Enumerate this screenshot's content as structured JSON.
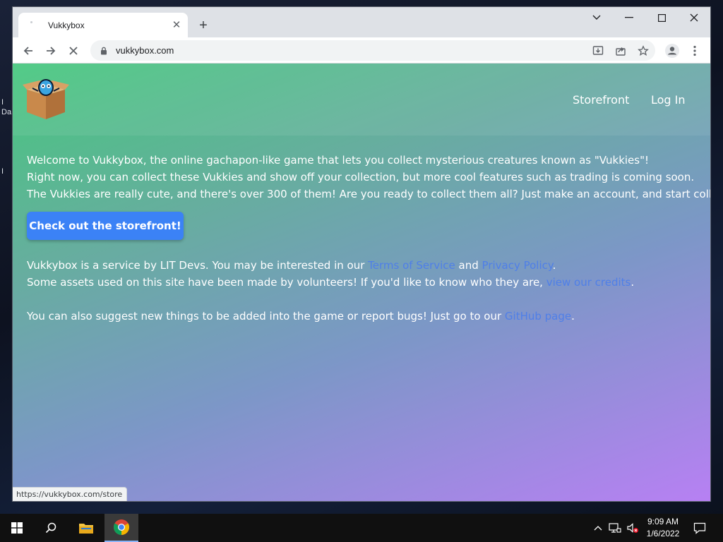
{
  "desktop": {
    "edge_labels": [
      "I",
      "Da",
      "I"
    ]
  },
  "browser": {
    "tab": {
      "title": "Vukkybox"
    },
    "address": {
      "url": "vukkybox.com"
    },
    "status_url": "https://vukkybox.com/store",
    "icons": {
      "back": "arrow-left-icon",
      "forward": "arrow-right-icon",
      "stop": "close-icon",
      "lock": "lock-icon",
      "install": "install-app-icon",
      "share": "share-icon",
      "bookmark": "star-icon",
      "profile": "profile-icon",
      "menu": "kebab-menu-icon"
    }
  },
  "site": {
    "nav": {
      "storefront": "Storefront",
      "login": "Log In"
    },
    "intro": [
      "Welcome to Vukkybox, the online gachapon-like game that lets you collect mysterious creatures known as \"Vukkies\"!",
      "Right now, you can collect these Vukkies and show off your collection, but more cool features such as trading is coming soon.",
      "The Vukkies are really cute, and there's over 300 of them! Are you ready to collect them all? Just make an account, and start collecting!"
    ],
    "cta_label": "Check out the storefront!",
    "about": {
      "prefix": "Vukkybox is a service by LIT Devs. You may be interested in our ",
      "tos_link": "Terms of Service",
      "and": " and ",
      "privacy_link": "Privacy Policy",
      "suffix": "."
    },
    "credits": {
      "prefix": "Some assets used on this site have been made by volunteers! If you'd like to know who they are, ",
      "link": "view our credits",
      "suffix": "."
    },
    "github": {
      "prefix": "You can also suggest new things to be added into the game or report bugs! Just go to our ",
      "link": "GitHub page",
      "suffix": "."
    }
  },
  "taskbar": {
    "time": "9:09 AM",
    "date": "1/6/2022"
  },
  "colors": {
    "accent_button": "#3b82f6",
    "link": "#4f7fe8",
    "gradient_start": "#46c77e",
    "gradient_end": "#b780f3"
  }
}
